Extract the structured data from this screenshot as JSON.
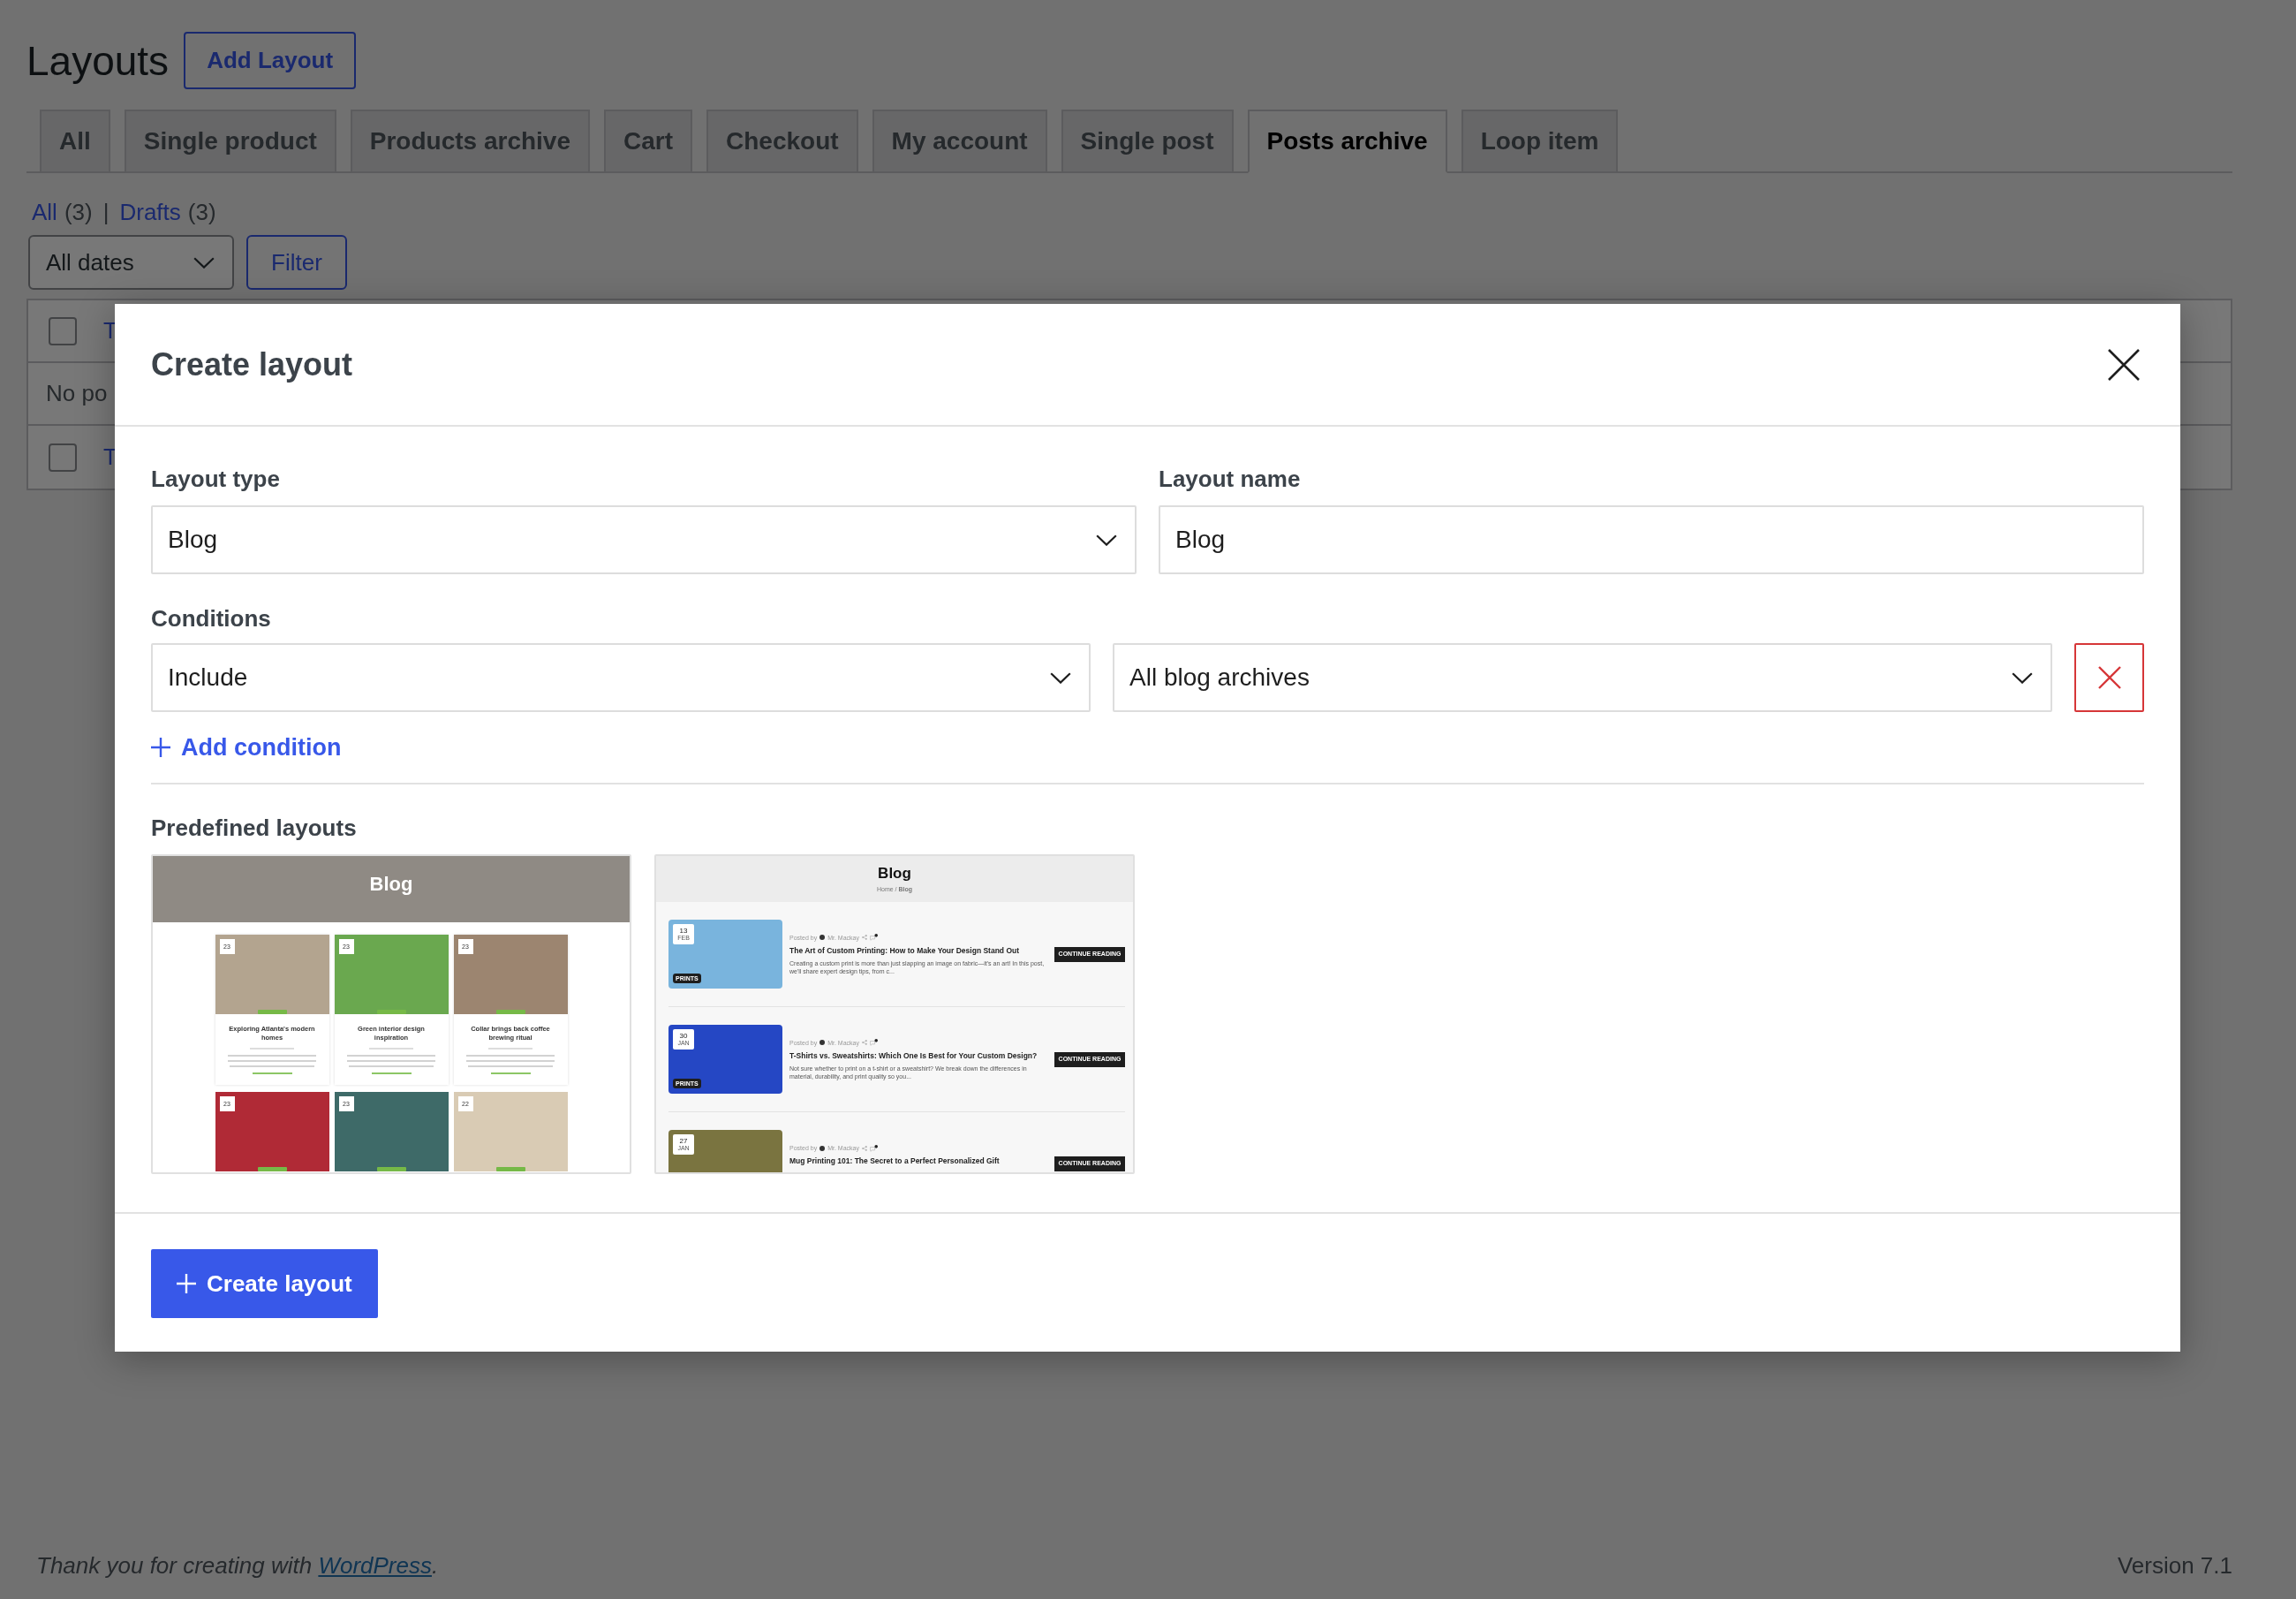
{
  "page": {
    "title": "Layouts",
    "add_button": "Add Layout",
    "tabs": [
      {
        "label": "All",
        "selected": false
      },
      {
        "label": "Single product",
        "selected": false
      },
      {
        "label": "Products archive",
        "selected": false
      },
      {
        "label": "Cart",
        "selected": false
      },
      {
        "label": "Checkout",
        "selected": false
      },
      {
        "label": "My account",
        "selected": false
      },
      {
        "label": "Single post",
        "selected": false
      },
      {
        "label": "Posts archive",
        "selected": true
      },
      {
        "label": "Loop item",
        "selected": false
      }
    ],
    "status_links": [
      {
        "label": "All",
        "count": "(3)"
      },
      {
        "label": "Drafts",
        "count": "(3)"
      }
    ],
    "status_separator": "|",
    "date_filter": "All dates",
    "filter_button": "Filter",
    "table_rows": [
      {
        "kind": "item",
        "checked": false,
        "title": "T"
      },
      {
        "kind": "message",
        "text": "No po"
      },
      {
        "kind": "item",
        "checked": false,
        "title": "T"
      }
    ],
    "footer": {
      "credit_before": "Thank you for creating with ",
      "credit_link": "WordPress",
      "credit_after": ".",
      "version": "Version 7.1"
    }
  },
  "modal": {
    "title": "Create layout",
    "fields": [
      {
        "kind": "select",
        "label": "Layout type",
        "value": "Blog"
      },
      {
        "kind": "text",
        "label": "Layout name",
        "value": "Blog"
      }
    ],
    "conditions_label": "Conditions",
    "conditions": [
      {
        "mode": "Include",
        "target": "All blog archives"
      }
    ],
    "add_condition": "Add condition",
    "predefined_label": "Predefined layouts",
    "predefined_layouts": [
      {
        "kind": "grid",
        "selected": false,
        "title": "Blog",
        "cards": [
          {
            "day": "23",
            "title": "Exploring Atlanta's modern homes"
          },
          {
            "day": "23",
            "title": "Green interior design inspiration"
          },
          {
            "day": "23",
            "title": "Collar brings back coffee brewing ritual"
          },
          {
            "day": "23"
          },
          {
            "day": "23"
          },
          {
            "day": "22"
          }
        ]
      },
      {
        "kind": "list",
        "selected": false,
        "title": "Blog",
        "breadcrumb": "Home / **Blog**",
        "posts": [
          {
            "day": "13",
            "month": "FEB",
            "tag": "PRINTS",
            "byline": "Posted by",
            "author": "Mr. Mackay",
            "title": "The Art of Custom Printing: How to Make Your Design Stand Out",
            "excerpt": "Creating a custom print is more than just slapping an image on fabric—it's an art! In this post, we'll share expert design tips, from c...",
            "button": "CONTINUE READING"
          },
          {
            "day": "30",
            "month": "JAN",
            "tag": "PRINTS",
            "byline": "Posted by",
            "author": "Mr. Mackay",
            "title": "T-Shirts vs. Sweatshirts: Which One Is Best for Your Custom Design?",
            "excerpt": "Not sure whether to print on a t-shirt or a sweatshirt? We break down the differences in material, durability, and print quality so you...",
            "button": "CONTINUE READING"
          },
          {
            "day": "27",
            "month": "JAN",
            "byline": "Posted by",
            "author": "Mr. Mackay",
            "title": "Mug Printing 101: The Secret to a Perfect Personalized Gift",
            "button": "CONTINUE READING"
          }
        ]
      }
    ],
    "create_button": "Create layout"
  }
}
